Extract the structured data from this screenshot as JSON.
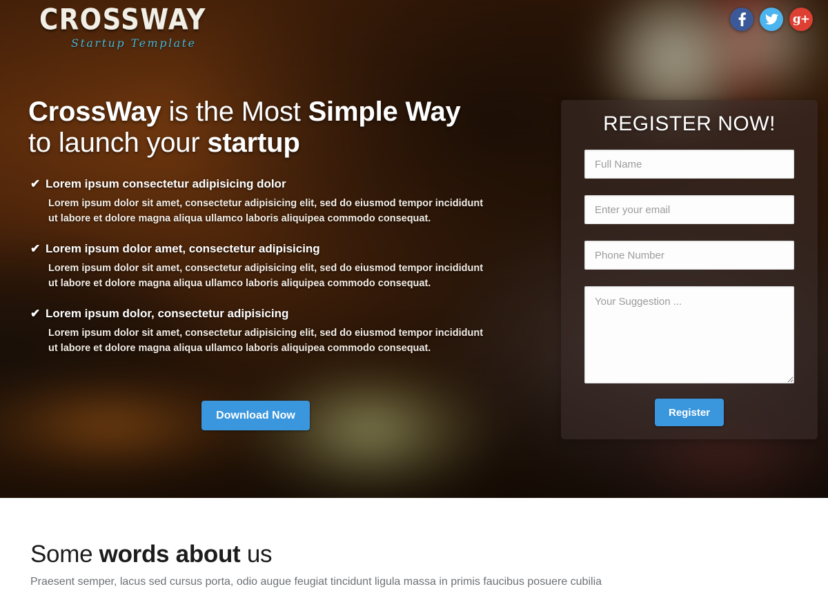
{
  "header": {
    "logo_main": "CROSSWAY",
    "logo_sub": "Startup Template",
    "social": [
      {
        "name": "facebook",
        "glyph": "f",
        "color": "#3b5998"
      },
      {
        "name": "twitter",
        "glyph": "t",
        "color": "#4cb4ee"
      },
      {
        "name": "googleplus",
        "glyph": "g+",
        "color": "#dd3f32"
      }
    ]
  },
  "hero": {
    "headline_part1": "CrossWay",
    "headline_part2": " is the Most ",
    "headline_part3": "Simple Way",
    "headline_part4": "to launch your ",
    "headline_part5": "startup",
    "check_glyph": "✔",
    "features": [
      {
        "title": "Lorem ipsum consectetur adipisicing dolor",
        "body": "Lorem ipsum dolor sit amet, consectetur adipisicing elit, sed do eiusmod tempor incididunt ut labore et dolore magna aliqua ullamco laboris aliquipea commodo consequat."
      },
      {
        "title": "Lorem ipsum dolor amet, consectetur adipisicing",
        "body": "Lorem ipsum dolor sit amet, consectetur adipisicing elit, sed do eiusmod tempor incididunt ut labore et dolore magna aliqua ullamco laboris aliquipea commodo consequat."
      },
      {
        "title": "Lorem ipsum dolor, consectetur adipisicing",
        "body": "Lorem ipsum dolor sit amet, consectetur adipisicing elit, sed do eiusmod tempor incididunt ut labore et dolore magna aliqua ullamco laboris aliquipea commodo consequat."
      }
    ],
    "download_label": "Download Now"
  },
  "register": {
    "title": "REGISTER NOW!",
    "full_name_placeholder": "Full Name",
    "full_name_value": "",
    "email_placeholder": "Enter your email",
    "email_value": "",
    "phone_placeholder": "Phone Number",
    "phone_value": "",
    "suggestion_placeholder": "Your Suggestion ...",
    "suggestion_value": "",
    "submit_label": "Register"
  },
  "about": {
    "title_part1": "Some ",
    "title_part2": "words about",
    "title_part3": " us",
    "subtitle": "Praesent semper, lacus sed cursus porta, odio augue feugiat tincidunt ligula massa in primis faucibus posuere cubilia"
  },
  "colors": {
    "accent_blue": "#3a96dd",
    "facebook": "#3b5998",
    "twitter": "#4cb4ee",
    "googleplus": "#dd3f32",
    "logo_sub": "#49b6d6"
  }
}
